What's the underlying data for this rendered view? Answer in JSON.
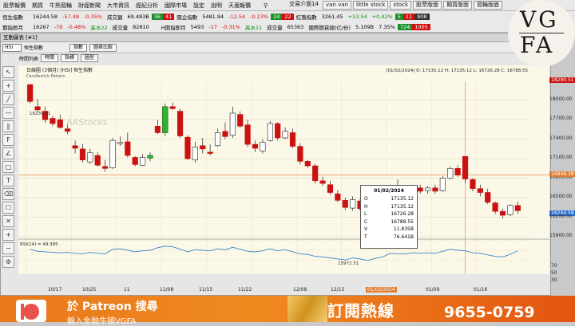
{
  "menubar": {
    "items": [
      "股票報價",
      "期貨",
      "牛熊窩輪",
      "財經新聞",
      "大市資訊",
      "經紀分析",
      "國際市場",
      "設定",
      "說明",
      "天滙報價"
    ],
    "right_items": [
      "van van",
      "little stock",
      "stock",
      "股票版面",
      "期貨版面",
      "窩輪版面"
    ],
    "market_status": "交易介面14"
  },
  "ticker1": {
    "name": "恒生指數",
    "last": "16244.58",
    "chg": "-57.48",
    "pct": "-0.35%",
    "turnover_label": "成交額",
    "turnover": "69.483B",
    "up": "36",
    "down": "41",
    "index2_name": "國企指數",
    "index2_last": "5481.94",
    "index2_chg": "-12.54",
    "index2_pct": "-0.23%",
    "b1": "24",
    "b2": "22",
    "index3_name": "紅籌指數",
    "index3_last": "3261.45",
    "index3_chg": "+13.54",
    "index3_pct": "+0.42%",
    "b3": "5",
    "b4": "11",
    "b5": "908"
  },
  "ticker2": {
    "name": "期指即月",
    "last": "16267",
    "chg": "-79",
    "pct": "-0.48%",
    "high_label": "高水22",
    "turnover_label": "成交量",
    "turnover": "82810",
    "index2_name": "H期指即月",
    "index2_last": "5493",
    "index2_chg": "-17",
    "index2_pct": "-0.31%",
    "index2_high": "高水11",
    "index2_vol_label": "成交量",
    "index2_vol": "65363",
    "index3_name": "國際期貨總(亿/份)",
    "index3_v1": "5.109B",
    "index3_v2": "7.35%",
    "b1": "724",
    "b2": "1005"
  },
  "chart_window": {
    "title": "互動圖表 [#1]",
    "symbol": "HSI",
    "symbol_name": "恒生指數",
    "toolbar": [
      "指數",
      "時間列表",
      "時間",
      "指標",
      "圖型",
      "圖表比較"
    ],
    "header_text": "日線圖 (3個月) [HSI] 恒生指數",
    "candle_pattern_label": "Candlestick Pattern",
    "watermark": "AAStocks",
    "header_right": "[01/02/2024] O: 17135.12 H: 17135.12 L: 16726.28 C: 16788.55",
    "annot_high": "18239.51",
    "annot_low": "15972.51",
    "rsi_label": "RSI(14) = 49.395"
  },
  "tooltip": {
    "date": "01/02/2024",
    "rows": [
      {
        "k": "O",
        "v": "17135.12"
      },
      {
        "k": "H",
        "v": "17135.12"
      },
      {
        "k": "L",
        "v": "16726.28"
      },
      {
        "k": "C",
        "v": "16788.55"
      },
      {
        "k": "V",
        "v": "11.835B"
      },
      {
        "k": "T",
        "v": "76.641B"
      }
    ]
  },
  "axis": {
    "price_labels": [
      "18290.51",
      "18000.00",
      "17700.00",
      "17400.00",
      "17100.00",
      "16800.00",
      "16500.00",
      "16244.58",
      "16200.00",
      "15900.00"
    ],
    "crosshair_price": "16848.38",
    "last_price": "16244.58",
    "rsi_labels": [
      "70",
      "50",
      "30"
    ],
    "x_labels": [
      "10/17",
      "10/25",
      "11",
      "11/08",
      "11/15",
      "11/22",
      "12/08",
      "12/15",
      "01/02/2024",
      "01/09",
      "01/16"
    ]
  },
  "banner": {
    "line1": "於 Patreon 搜尋",
    "line2": "輸入金融牛頓VGFA",
    "cta": "訂閱熱線",
    "phone": "9655-0759"
  },
  "logo": {
    "line1": "VG",
    "line2": "FA"
  },
  "chart_data": {
    "type": "candlestick",
    "title": "恒生指數",
    "ylabel": "",
    "ylim": [
      15900,
      18290
    ],
    "note": "Candles read approximately from chart; daily OHLC",
    "candles": [
      [
        18240,
        18240,
        17950,
        17980
      ],
      [
        17900,
        18020,
        17820,
        17850
      ],
      [
        17830,
        17900,
        17650,
        17700
      ],
      [
        17720,
        17760,
        17600,
        17640
      ],
      [
        17700,
        17780,
        17560,
        17580
      ],
      [
        17560,
        17620,
        17480,
        17520
      ],
      [
        17300,
        17380,
        17180,
        17260
      ],
      [
        17250,
        17330,
        17040,
        17080
      ],
      [
        17050,
        17250,
        17020,
        17190
      ],
      [
        17150,
        17200,
        16980,
        17000
      ],
      [
        16980,
        17080,
        16900,
        16950
      ],
      [
        16960,
        17420,
        16940,
        17380
      ],
      [
        17330,
        17440,
        17300,
        17350
      ],
      [
        17360,
        17500,
        17120,
        17150
      ],
      [
        17120,
        17140,
        16980,
        17010
      ],
      [
        17000,
        17170,
        16990,
        17120
      ],
      [
        17110,
        17200,
        17060,
        17150
      ],
      [
        17600,
        17700,
        17480,
        17500
      ],
      [
        17500,
        17950,
        17450,
        17900
      ],
      [
        17900,
        17960,
        17850,
        17870
      ],
      [
        17830,
        17870,
        17420,
        17450
      ],
      [
        17430,
        17460,
        17080,
        17100
      ],
      [
        17080,
        17360,
        17040,
        17280
      ],
      [
        17300,
        17420,
        17180,
        17250
      ],
      [
        17200,
        17320,
        17150,
        17180
      ],
      [
        17300,
        17560,
        17280,
        17500
      ],
      [
        17520,
        17660,
        17400,
        17440
      ],
      [
        17460,
        17900,
        17420,
        17800
      ],
      [
        17780,
        17830,
        17580,
        17600
      ],
      [
        17620,
        17700,
        17280,
        17320
      ],
      [
        17320,
        17380,
        17200,
        17260
      ],
      [
        17220,
        17400,
        17180,
        17350
      ],
      [
        17380,
        17680,
        17360,
        17640
      ],
      [
        17640,
        17660,
        17380,
        17420
      ],
      [
        17420,
        17580,
        17400,
        17520
      ],
      [
        17500,
        17560,
        17260,
        17290
      ],
      [
        17290,
        17340,
        17010,
        17060
      ],
      [
        17060,
        17080,
        16960,
        16990
      ],
      [
        16990,
        17020,
        16720,
        16760
      ],
      [
        16760,
        16820,
        16680,
        16720
      ],
      [
        16700,
        16760,
        16540,
        16580
      ],
      [
        16560,
        16620,
        16430,
        16460
      ],
      [
        16460,
        16500,
        16310,
        16350
      ],
      [
        16340,
        16520,
        16300,
        16470
      ],
      [
        16450,
        16480,
        16300,
        16330
      ],
      [
        16320,
        16360,
        16180,
        16220
      ],
      [
        16200,
        16340,
        16160,
        16300
      ],
      [
        16310,
        16420,
        16270,
        16380
      ],
      [
        16400,
        16700,
        16390,
        16650
      ],
      [
        16660,
        16780,
        16560,
        16620
      ],
      [
        16620,
        16660,
        16540,
        16600
      ],
      [
        16580,
        16700,
        16520,
        16650
      ],
      [
        16650,
        16700,
        16560,
        16600
      ],
      [
        16610,
        16680,
        16560,
        16650
      ],
      [
        16650,
        16700,
        16560,
        16600
      ],
      [
        16610,
        16830,
        16590,
        16800
      ],
      [
        16800,
        16980,
        16780,
        16950
      ],
      [
        16950,
        17000,
        16820,
        16850
      ],
      [
        17135,
        17135,
        16726,
        16788
      ],
      [
        16780,
        16800,
        16600,
        16640
      ],
      [
        16640,
        16700,
        16520,
        16580
      ],
      [
        16580,
        16640,
        16400,
        16430
      ],
      [
        16420,
        16440,
        16250,
        16290
      ],
      [
        16290,
        16330,
        16180,
        16230
      ],
      [
        16240,
        16400,
        16220,
        16380
      ],
      [
        16380,
        16440,
        16250,
        16300
      ]
    ],
    "rsi": [
      52,
      48,
      47,
      46,
      45,
      46,
      44,
      43,
      46,
      44,
      43,
      52,
      53,
      50,
      47,
      49,
      50,
      55,
      58,
      57,
      52,
      47,
      51,
      50,
      49,
      53,
      51,
      56,
      52,
      48,
      47,
      49,
      53,
      49,
      51,
      47,
      43,
      42,
      38,
      37,
      35,
      33,
      31,
      35,
      33,
      30,
      34,
      37,
      44,
      43,
      43,
      45,
      44,
      45,
      44,
      48,
      52,
      50,
      49,
      45,
      44,
      41,
      38,
      37,
      42,
      49
    ]
  }
}
